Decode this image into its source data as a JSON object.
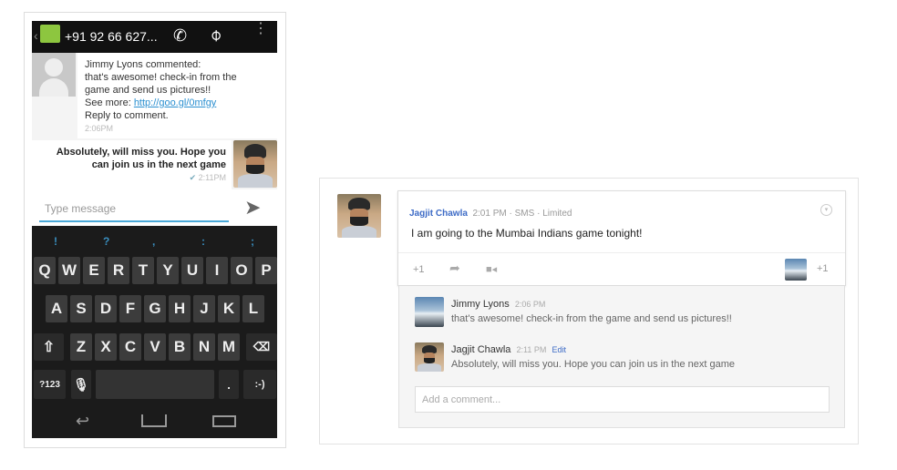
{
  "phone": {
    "contact": "+91 92 66 627...",
    "incoming": {
      "lines": [
        "Jimmy Lyons commented:",
        "that's awesome! check-in from the",
        "game and send us pictures!!"
      ],
      "see_more_label": "See more: ",
      "link": "http://goo.gl/0mfgy",
      "reply": "Reply to comment.",
      "time": "2:06PM"
    },
    "outgoing": {
      "lines": [
        "Absolutely, will miss you. Hope you",
        "can join us in the next game"
      ],
      "time": "2:11PM"
    },
    "input_placeholder": "Type message",
    "suggestions": [
      "!",
      "?",
      ",",
      ":",
      ";"
    ],
    "row1": [
      "Q",
      "W",
      "E",
      "R",
      "T",
      "Y",
      "U",
      "I",
      "O",
      "P"
    ],
    "row2": [
      "A",
      "S",
      "D",
      "F",
      "G",
      "H",
      "J",
      "K",
      "L"
    ],
    "row3": [
      "Z",
      "X",
      "C",
      "V",
      "B",
      "N",
      "M"
    ],
    "sym_label": "?123",
    "period": ".",
    "emoji": ":-)"
  },
  "post": {
    "author": "Jagjit Chawla",
    "time": "2:01 PM",
    "via": "SMS",
    "visibility": "Limited",
    "sep": "·",
    "text": "I am going to the Mumbai Indians game tonight!",
    "plus_one": "+1",
    "plus_count": "+1",
    "comments": [
      {
        "author": "Jimmy Lyons",
        "time": "2:06 PM",
        "text": "that's awesome! check-in from the game and send us pictures!!"
      },
      {
        "author": "Jagjit Chawla",
        "time": "2:11 PM",
        "edit": "Edit",
        "text": "Absolutely, will miss you. Hope you can join us in the next game"
      }
    ],
    "add_comment_placeholder": "Add a comment..."
  }
}
